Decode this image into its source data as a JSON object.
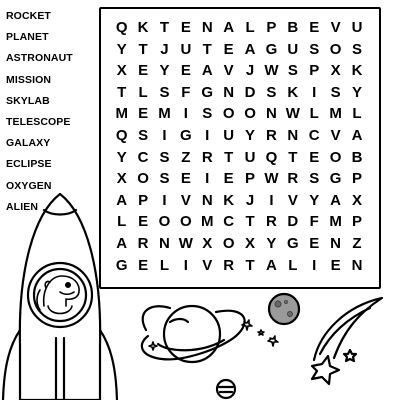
{
  "words": [
    "ROCKET",
    "PLANET",
    "ASTRONAUT",
    "MISSION",
    "SKYLAB",
    "TELESCOPE",
    "GALAXY",
    "ECLIPSE",
    "OXYGEN",
    "ALIEN"
  ],
  "grid": [
    [
      "Q",
      "K",
      "T",
      "E",
      "N",
      "A",
      "L",
      "P",
      "B",
      "E",
      "V",
      "U"
    ],
    [
      "Y",
      "T",
      "J",
      "U",
      "T",
      "E",
      "A",
      "G",
      "U",
      "S",
      "O",
      "S"
    ],
    [
      "X",
      "E",
      "Y",
      "E",
      "A",
      "V",
      "J",
      "W",
      "S",
      "P",
      "X",
      "K"
    ],
    [
      "T",
      "L",
      "S",
      "F",
      "G",
      "N",
      "D",
      "S",
      "K",
      "I",
      "S",
      "Y"
    ],
    [
      "M",
      "E",
      "M",
      "I",
      "S",
      "O",
      "O",
      "N",
      "W",
      "L",
      "M",
      "L"
    ],
    [
      "Q",
      "S",
      "I",
      "G",
      "I",
      "U",
      "Y",
      "R",
      "N",
      "C",
      "V",
      "A"
    ],
    [
      "Y",
      "C",
      "S",
      "Z",
      "R",
      "T",
      "U",
      "Q",
      "T",
      "E",
      "O",
      "B"
    ],
    [
      "X",
      "O",
      "S",
      "E",
      "I",
      "E",
      "P",
      "W",
      "R",
      "S",
      "G",
      "P"
    ],
    [
      "A",
      "P",
      "I",
      "V",
      "N",
      "K",
      "J",
      "I",
      "V",
      "Y",
      "A",
      "X"
    ],
    [
      "L",
      "E",
      "O",
      "O",
      "M",
      "C",
      "T",
      "R",
      "D",
      "F",
      "M",
      "P"
    ],
    [
      "A",
      "R",
      "N",
      "W",
      "X",
      "O",
      "X",
      "Y",
      "G",
      "E",
      "N",
      "Z"
    ],
    [
      "G",
      "E",
      "L",
      "I",
      "V",
      "R",
      "T",
      "A",
      "L",
      "I",
      "E",
      "N"
    ]
  ],
  "illustrations": [
    "rocket-icon",
    "dinosaur-astronaut-icon",
    "saturn-icon",
    "moon-icon",
    "star-icon",
    "shooting-star-icon",
    "small-planet-icon"
  ]
}
